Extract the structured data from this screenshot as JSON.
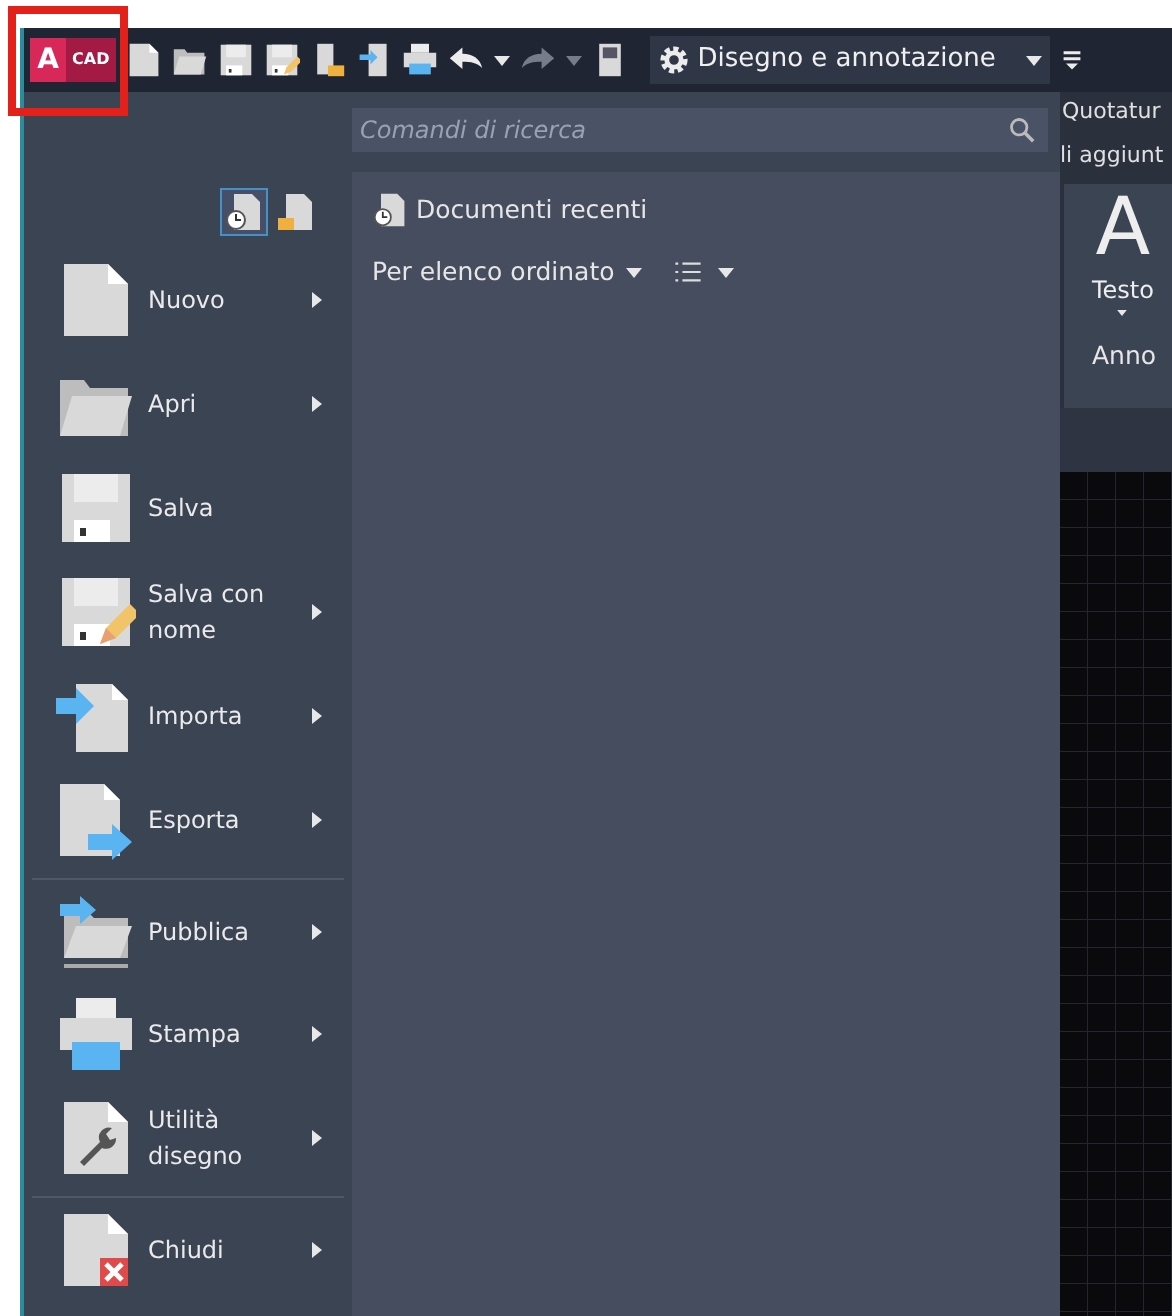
{
  "toolbar": {
    "logo_letter": "A",
    "logo_text": "CAD",
    "workspace": "Disegno e annotazione"
  },
  "search": {
    "placeholder": "Comandi di ricerca"
  },
  "view_toggles": [
    {
      "kind": "recent",
      "selected": true
    },
    {
      "kind": "open",
      "selected": false
    }
  ],
  "menu": {
    "items": [
      {
        "label": "Nuovo",
        "kind": "new",
        "submenu": true,
        "separator_before": false
      },
      {
        "label": "Apri",
        "kind": "open",
        "submenu": true,
        "separator_before": false
      },
      {
        "label": "Salva",
        "kind": "save",
        "submenu": false,
        "separator_before": false
      },
      {
        "label": "Salva con nome",
        "kind": "saveas",
        "submenu": true,
        "separator_before": false
      },
      {
        "label": "Importa",
        "kind": "import",
        "submenu": true,
        "separator_before": false
      },
      {
        "label": "Esporta",
        "kind": "export",
        "submenu": true,
        "separator_before": false
      },
      {
        "label": "Pubblica",
        "kind": "publish",
        "submenu": true,
        "separator_before": true
      },
      {
        "label": "Stampa",
        "kind": "print",
        "submenu": true,
        "separator_before": false
      },
      {
        "label": "Utilità disegno",
        "kind": "utilities",
        "submenu": true,
        "separator_before": false
      },
      {
        "label": "Chiudi",
        "kind": "close",
        "submenu": true,
        "separator_before": true
      }
    ]
  },
  "recent": {
    "title": "Documenti recenti",
    "sort": "Per elenco ordinato"
  },
  "ribbon": {
    "tab": "Quotatur",
    "panel_row": "li aggiunt",
    "tool_glyph": "A",
    "tool": "Testo",
    "group": "Anno"
  }
}
